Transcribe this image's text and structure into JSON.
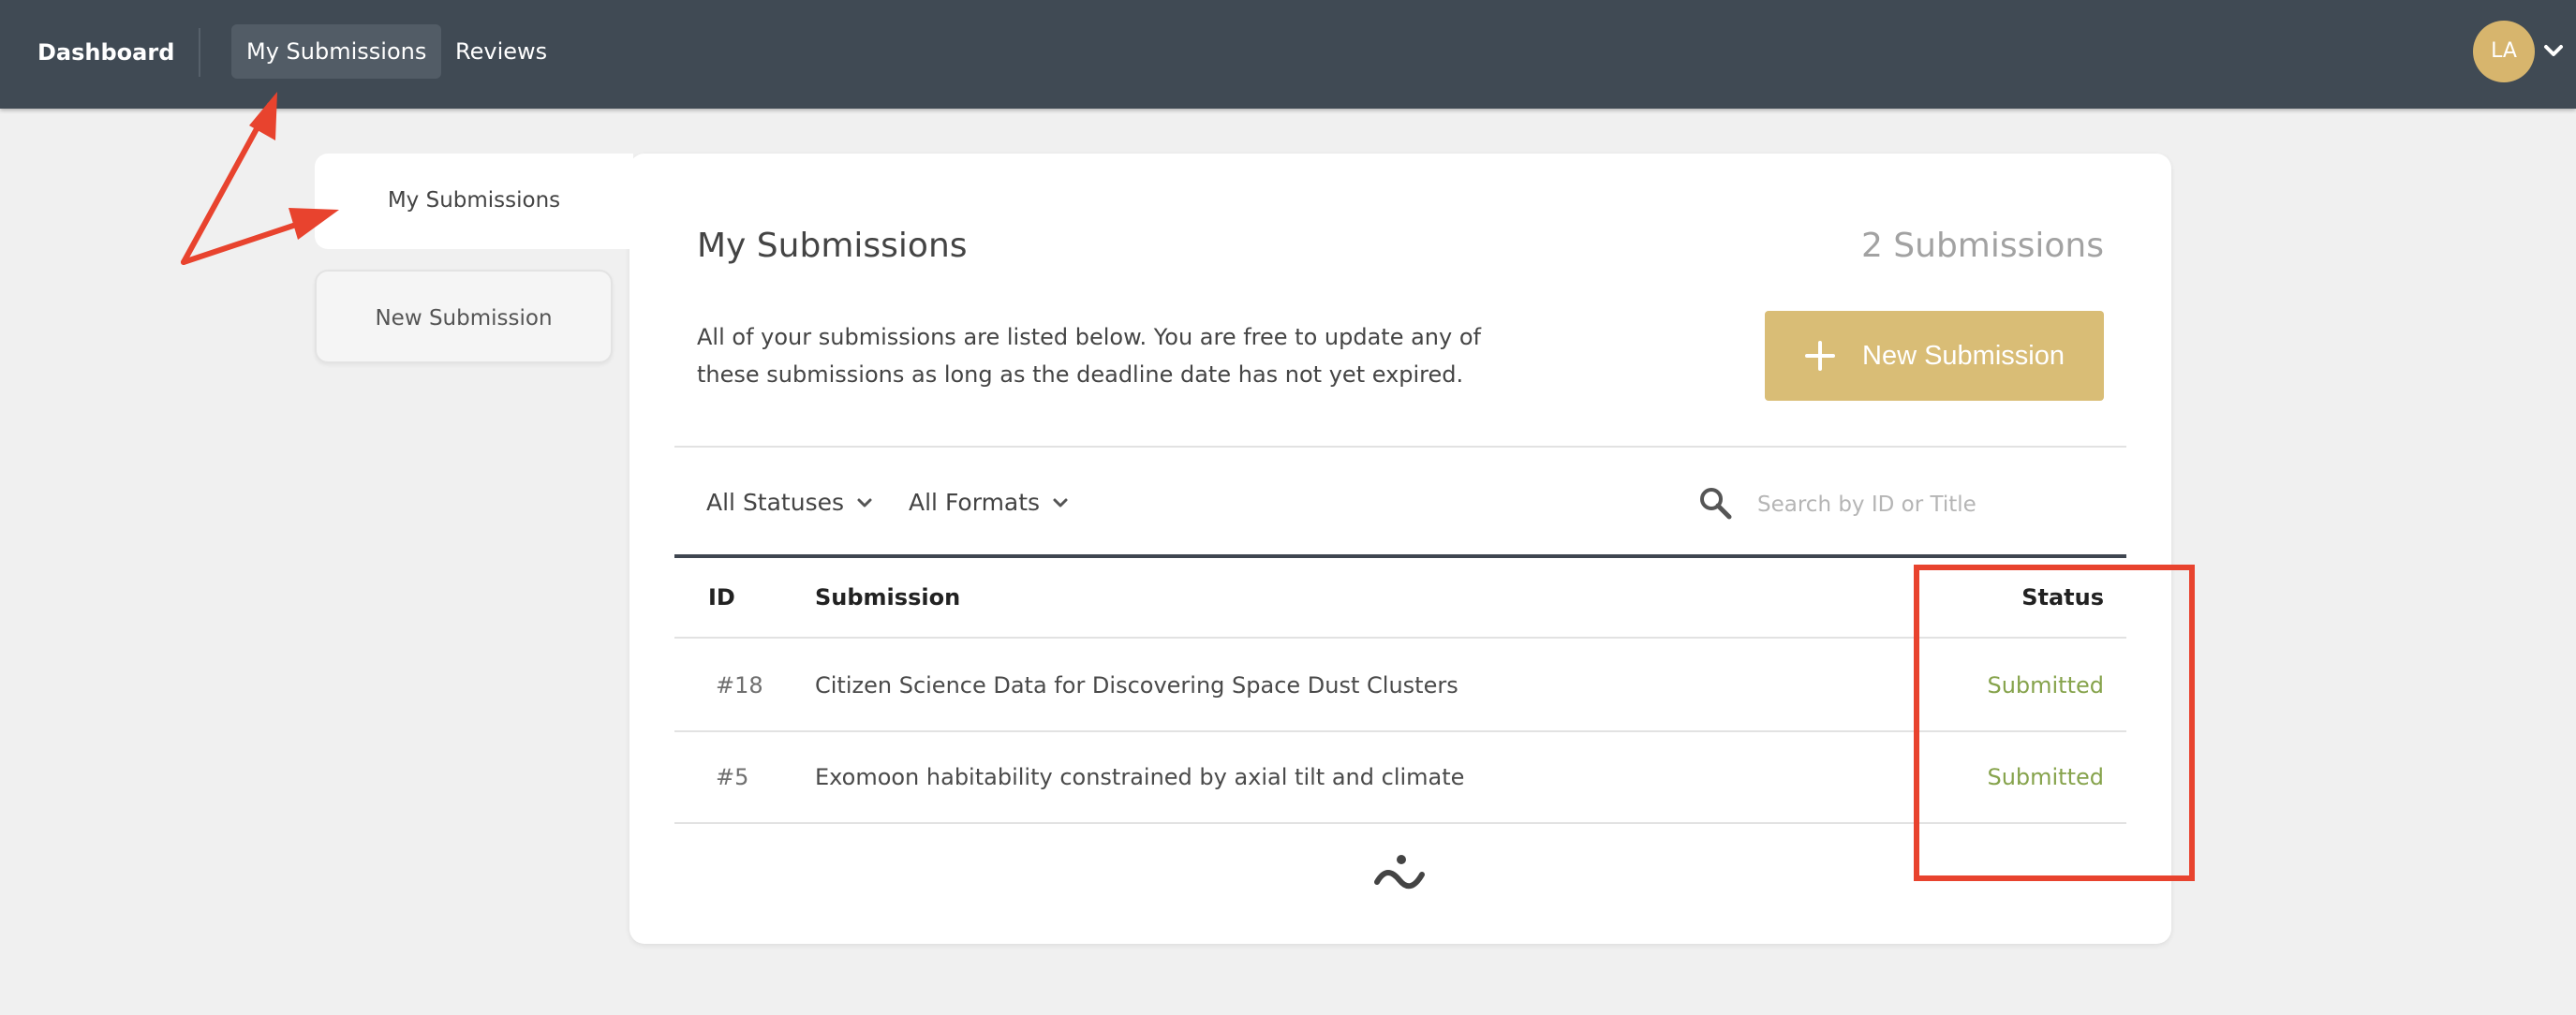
{
  "topnav": {
    "brand": "Dashboard",
    "items": [
      {
        "label": "My Submissions",
        "active": true
      },
      {
        "label": "Reviews",
        "active": false
      }
    ],
    "user_initials": "LA"
  },
  "sidebar": {
    "tabs": [
      {
        "label": "My Submissions",
        "active": true
      },
      {
        "label": "New Submission",
        "active": false
      }
    ]
  },
  "main": {
    "title": "My Submissions",
    "count_label": "2 Submissions",
    "description": "All of your submissions are listed below. You are free to update any of these submissions as long as the deadline date has not yet expired.",
    "new_button_label": "New Submission",
    "filters": {
      "status": "All Statuses",
      "format": "All Formats"
    },
    "search": {
      "placeholder": "Search by ID or Title",
      "value": ""
    },
    "table": {
      "headers": {
        "id": "ID",
        "submission": "Submission",
        "status": "Status"
      },
      "rows": [
        {
          "id": "#18",
          "title": "Citizen Science Data for Discovering Space Dust Clusters",
          "status": "Submitted"
        },
        {
          "id": "#5",
          "title": "Exomoon habitability constrained by axial tilt and climate",
          "status": "Submitted"
        }
      ]
    }
  },
  "colors": {
    "nav_bg": "#404a54",
    "accent_gold": "#d9bd76",
    "status_green": "#86a34c",
    "annotation_red": "#e8432e"
  }
}
